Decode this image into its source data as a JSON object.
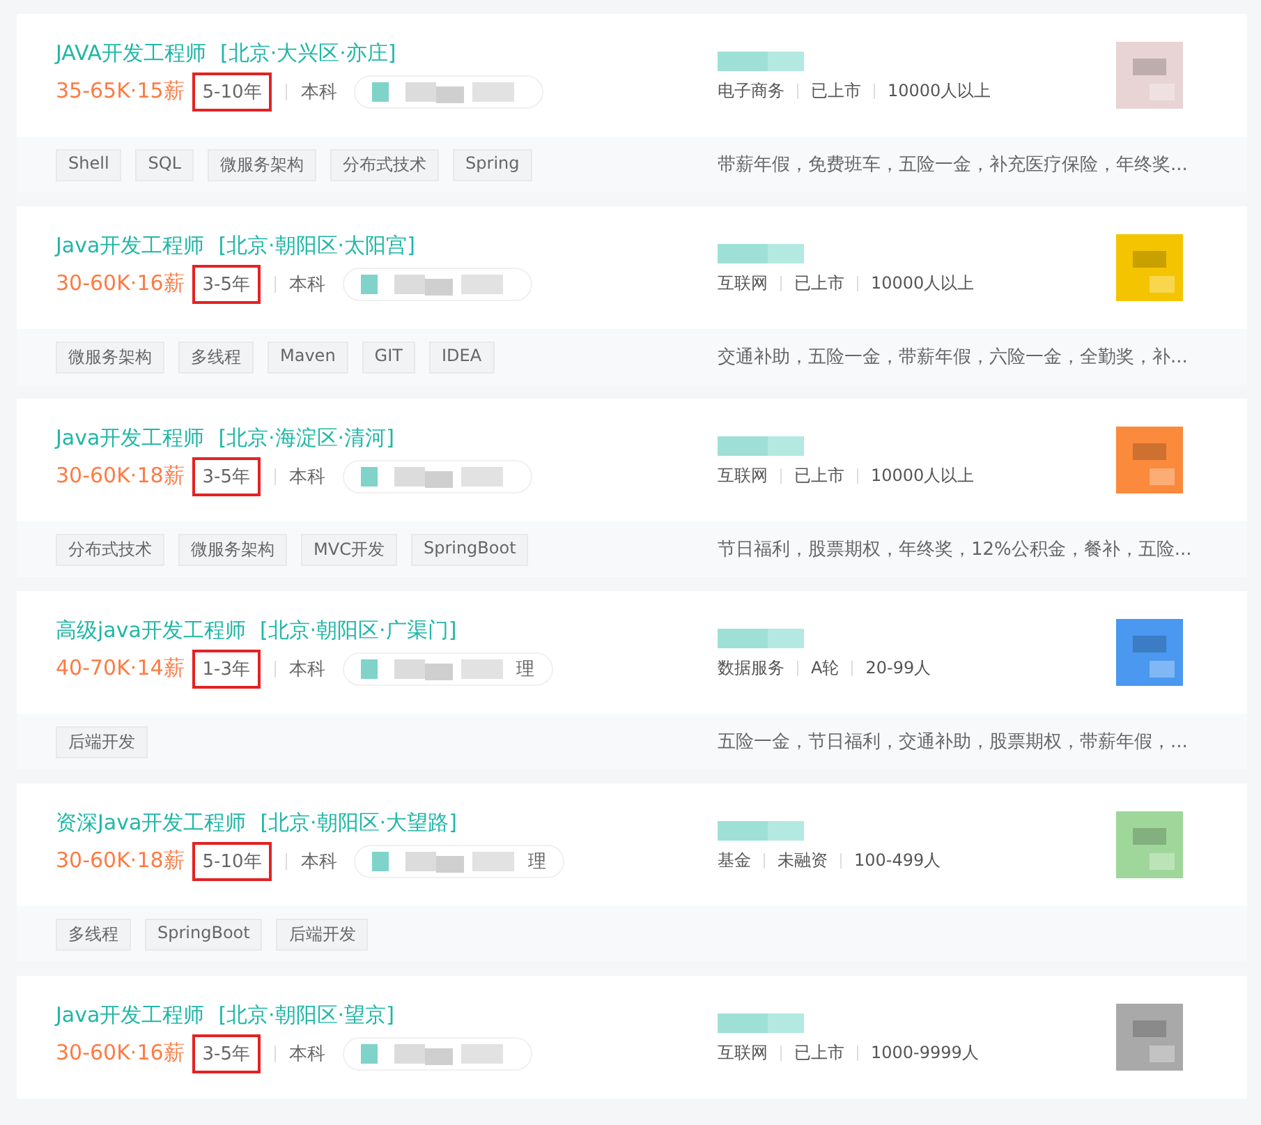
{
  "jobs": [
    {
      "title": "JAVA开发工程师",
      "location": "[北京·大兴区·亦庄]",
      "salary": "35-65K·15薪",
      "experience": "5-10年",
      "highlighted": true,
      "education": "本科",
      "industry": "电子商务",
      "funding": "已上市",
      "size": "10000人以上",
      "color": "#e8d4d4",
      "tags": [
        "Shell",
        "SQL",
        "微服务架构",
        "分布式技术",
        "Spring"
      ],
      "benefits": "带薪年假，免费班车，五险一金，补充医疗保险，年终奖..."
    },
    {
      "title": "Java开发工程师",
      "location": "[北京·朝阳区·太阳宫]",
      "salary": "30-60K·16薪",
      "experience": "3-5年",
      "highlighted": true,
      "education": "本科",
      "industry": "互联网",
      "funding": "已上市",
      "size": "10000人以上",
      "color": "#f5c400",
      "tags": [
        "微服务架构",
        "多线程",
        "Maven",
        "GIT",
        "IDEA"
      ],
      "benefits": "交通补助，五险一金，带薪年假，六险一金，全勤奖，补..."
    },
    {
      "title": "Java开发工程师",
      "location": "[北京·海淀区·清河]",
      "salary": "30-60K·18薪",
      "experience": "3-5年",
      "highlighted": true,
      "education": "本科",
      "industry": "互联网",
      "funding": "已上市",
      "size": "10000人以上",
      "color": "#fb8a3c",
      "tags": [
        "分布式技术",
        "微服务架构",
        "MVC开发",
        "SpringBoot"
      ],
      "benefits": "节日福利，股票期权，年终奖，12%公积金，餐补，五险..."
    },
    {
      "title": "高级java开发工程师",
      "location": "[北京·朝阳区·广渠门]",
      "salary": "40-70K·14薪",
      "experience": "1-3年",
      "highlighted": true,
      "education": "本科",
      "recruiter_fragment": "理",
      "industry": "数据服务",
      "funding": "A轮",
      "size": "20-99人",
      "color": "#4a98f0",
      "tags": [
        "后端开发"
      ],
      "benefits": "五险一金，节日福利，交通补助，股票期权，带薪年假，..."
    },
    {
      "title": "资深Java开发工程师",
      "location": "[北京·朝阳区·大望路]",
      "salary": "30-60K·18薪",
      "experience": "5-10年",
      "highlighted": true,
      "education": "本科",
      "recruiter_fragment": "理",
      "industry": "基金",
      "funding": "未融资",
      "size": "100-499人",
      "color": "#9fd79a",
      "tags": [
        "多线程",
        "SpringBoot",
        "后端开发"
      ]
    },
    {
      "title": "Java开发工程师",
      "location": "[北京·朝阳区·望京]",
      "salary": "30-60K·16薪",
      "experience": "3-5年",
      "highlighted": true,
      "education": "本科",
      "industry": "互联网",
      "funding": "已上市",
      "size": "1000-9999人",
      "color": "#a9a9a9"
    }
  ]
}
